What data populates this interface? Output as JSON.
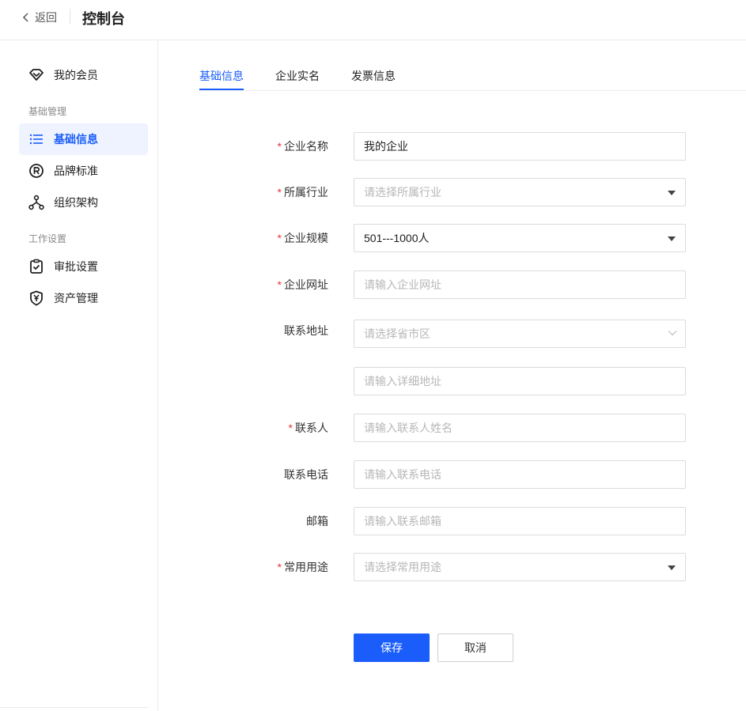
{
  "header": {
    "back_label": "返回",
    "title": "控制台"
  },
  "sidebar": {
    "member": {
      "label": "我的会员",
      "icon": "diamond-icon"
    },
    "groups": [
      {
        "title": "基础管理",
        "items": [
          {
            "label": "基础信息",
            "icon": "list-icon",
            "active": true
          },
          {
            "label": "品牌标准",
            "icon": "registered-icon"
          },
          {
            "label": "组织架构",
            "icon": "org-chart-icon"
          }
        ]
      },
      {
        "title": "工作设置",
        "items": [
          {
            "label": "审批设置",
            "icon": "clipboard-check-icon"
          },
          {
            "label": "资产管理",
            "icon": "yuan-shield-icon"
          }
        ]
      }
    ]
  },
  "tabs": [
    {
      "label": "基础信息",
      "active": true
    },
    {
      "label": "企业实名"
    },
    {
      "label": "发票信息"
    }
  ],
  "form": {
    "company_name": {
      "label": "企业名称",
      "required": true,
      "value": "我的企业"
    },
    "industry": {
      "label": "所属行业",
      "required": true,
      "placeholder": "请选择所属行业"
    },
    "scale": {
      "label": "企业规模",
      "required": true,
      "value": "501---1000人"
    },
    "website": {
      "label": "企业网址",
      "required": true,
      "placeholder": "请输入企业网址"
    },
    "address": {
      "label": "联系地址",
      "required": false,
      "region_placeholder": "请选择省市区",
      "detail_placeholder": "请输入详细地址"
    },
    "contact": {
      "label": "联系人",
      "required": true,
      "placeholder": "请输入联系人姓名"
    },
    "phone": {
      "label": "联系电话",
      "required": false,
      "placeholder": "请输入联系电话"
    },
    "email": {
      "label": "邮箱",
      "required": false,
      "placeholder": "请输入联系邮箱"
    },
    "usage": {
      "label": "常用用途",
      "required": true,
      "placeholder": "请选择常用用途"
    },
    "required_mark": "*"
  },
  "actions": {
    "save_label": "保存",
    "cancel_label": "取消"
  },
  "colors": {
    "accent": "#1a5dfa",
    "required": "#e53935",
    "active_bg": "#eef3ff"
  }
}
